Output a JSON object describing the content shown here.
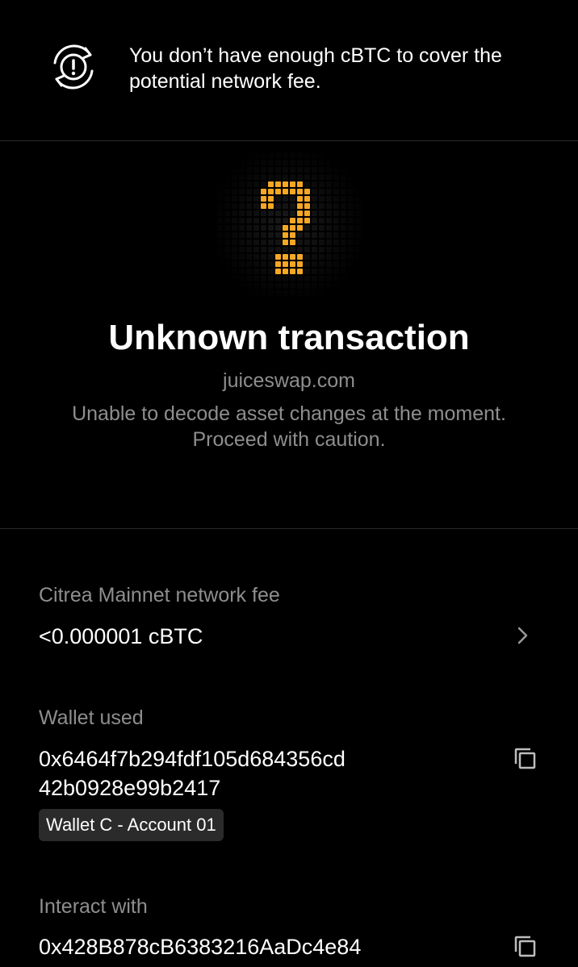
{
  "banner": {
    "icon": "warning-circle-icon",
    "message": "You don’t have enough cBTC to cover the potential network fee."
  },
  "transaction": {
    "icon": "pixel-question-mark-icon",
    "accent_color": "#F7A823",
    "title": "Unknown transaction",
    "origin": "juiceswap.com",
    "description": "Unable to decode asset changes at the moment. Proceed with caution."
  },
  "network_fee": {
    "label": "Citrea Mainnet network fee",
    "value": "<0.000001 cBTC",
    "icon": "chevron-right-icon"
  },
  "wallet": {
    "label": "Wallet used",
    "address_line1": "0x6464f7b294fdf105d684356cd",
    "address_line2": "42b0928e99b2417",
    "account_name": "Wallet C - Account 01",
    "icon": "copy-icon"
  },
  "interact": {
    "label": "Interact with",
    "address": "0x428B878cB6383216AaDc4e84",
    "icon": "copy-icon"
  }
}
